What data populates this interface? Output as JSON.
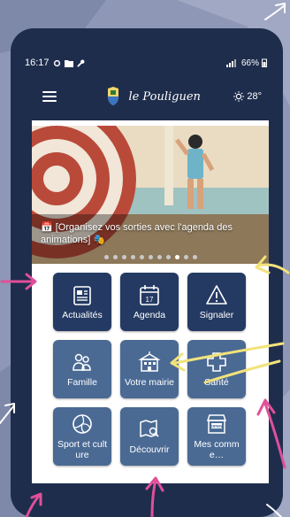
{
  "status_bar": {
    "time": "16:17",
    "battery": "66%"
  },
  "app_bar": {
    "brand_name": "le Pouliguen",
    "temperature": "28°"
  },
  "banner": {
    "caption": "📅 [Organisez vos sorties avec l'agenda des animations] 🎭",
    "slides": 11,
    "active_slide": 9
  },
  "tiles": [
    {
      "label": "Actualités",
      "icon": "newspaper-icon"
    },
    {
      "label": "Agenda",
      "icon": "calendar-17-icon"
    },
    {
      "label": "Signaler",
      "icon": "warning-triangle-icon"
    },
    {
      "label": "Famille",
      "icon": "family-icon"
    },
    {
      "label": "Votre mairie",
      "icon": "town-hall-icon"
    },
    {
      "label": "Santé",
      "icon": "health-icon"
    },
    {
      "label": "Sport et culture",
      "icon": "volleyball-icon"
    },
    {
      "label": "Découvrir",
      "icon": "map-search-icon"
    },
    {
      "label": "Mes comme…",
      "icon": "shop-open-icon"
    }
  ],
  "colors": {
    "navy": "#1f2d4d",
    "tile": "#243a63",
    "tile_light": "#4a6a94",
    "background": "#8e97b6",
    "arrow_pink": "#e0509a",
    "arrow_yellow": "#f2e27a"
  }
}
